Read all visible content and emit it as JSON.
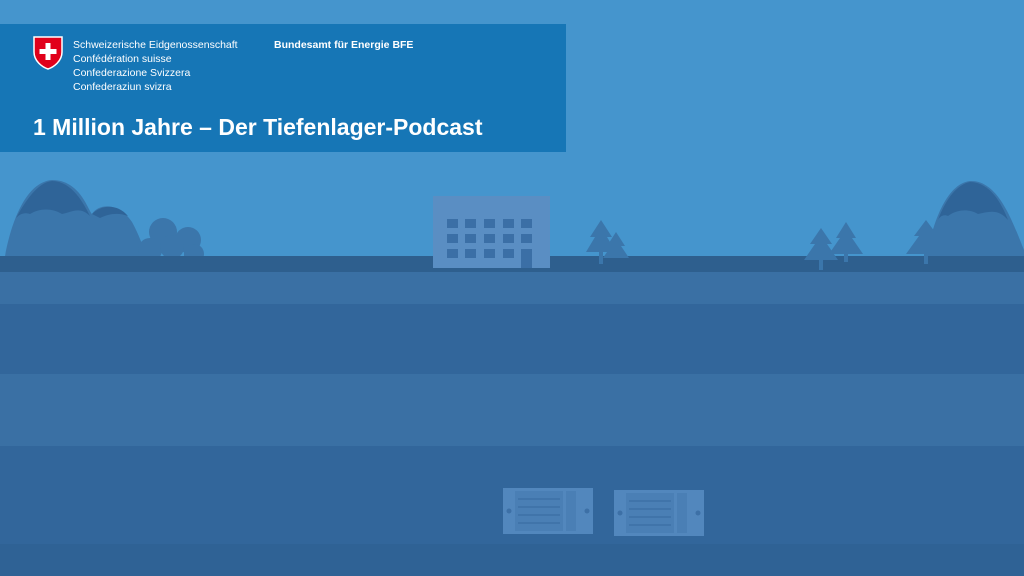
{
  "header": {
    "government_lines": [
      "Schweizerische Eidgenossenschaft",
      "Confédération suisse",
      "Confederazione Svizzera",
      "Confederaziun svizra"
    ],
    "office_name": "Bundesamt für Energie BFE",
    "podcast_title": "1 Million Jahre – Der Tiefenlager-Podcast",
    "coat_of_arms_icon": "swiss-coat-of-arms-icon"
  },
  "colors": {
    "sky": "#4595cd",
    "banner": "#1676b6",
    "swiss_red": "#e1001a",
    "landscape": "#3b76ab",
    "ground_surface": "#2e5f8e",
    "soil_layer_light": "#3a70a4",
    "soil_layer_dark": "#32669b",
    "canister": "#5287bd"
  },
  "scene": {
    "landscape_icons": [
      "mountain-icon",
      "tree-icon",
      "building-icon",
      "storage-canister-icon"
    ]
  }
}
